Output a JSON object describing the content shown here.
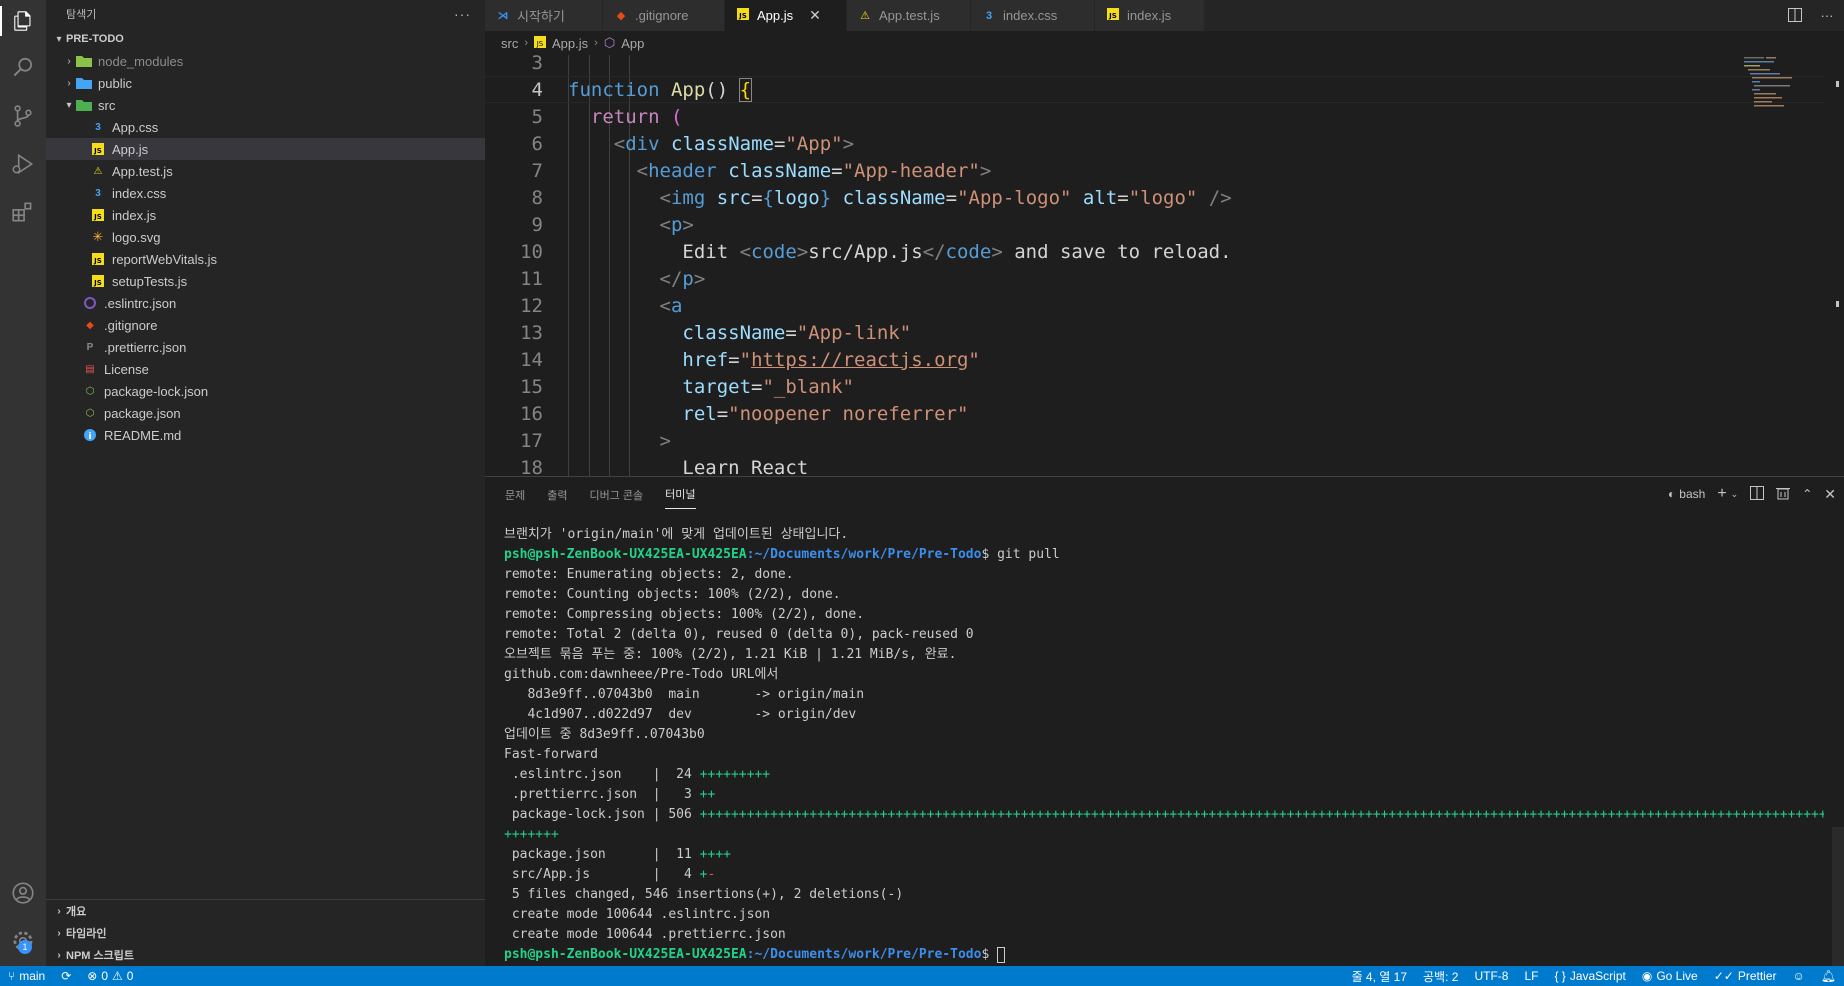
{
  "sidebar": {
    "title": "탐색기",
    "root": "PRE-TODO",
    "items": [
      {
        "label": "node_modules",
        "kind": "folder"
      },
      {
        "label": "public",
        "kind": "folder"
      },
      {
        "label": "src",
        "kind": "folder-open"
      },
      {
        "label": "App.css",
        "kind": "css"
      },
      {
        "label": "App.js",
        "kind": "js"
      },
      {
        "label": "App.test.js",
        "kind": "test"
      },
      {
        "label": "index.css",
        "kind": "css"
      },
      {
        "label": "index.js",
        "kind": "js"
      },
      {
        "label": "logo.svg",
        "kind": "svg"
      },
      {
        "label": "reportWebVitals.js",
        "kind": "js"
      },
      {
        "label": "setupTests.js",
        "kind": "js"
      },
      {
        "label": ".eslintrc.json",
        "kind": "eslint"
      },
      {
        "label": ".gitignore",
        "kind": "git"
      },
      {
        "label": ".prettierrc.json",
        "kind": "prettier"
      },
      {
        "label": "License",
        "kind": "license"
      },
      {
        "label": "package-lock.json",
        "kind": "npm"
      },
      {
        "label": "package.json",
        "kind": "npm"
      },
      {
        "label": "README.md",
        "kind": "info"
      }
    ],
    "bottom_sections": [
      "개요",
      "타임라인",
      "NPM 스크립트"
    ]
  },
  "tabs": [
    {
      "label": "시작하기",
      "icon": "vscode-icon",
      "active": false
    },
    {
      "label": ".gitignore",
      "icon": "git-icon",
      "active": false
    },
    {
      "label": "App.js",
      "icon": "js-icon",
      "active": true
    },
    {
      "label": "App.test.js",
      "icon": "test-icon",
      "active": false
    },
    {
      "label": "index.css",
      "icon": "css-icon",
      "active": false
    },
    {
      "label": "index.js",
      "icon": "js-icon",
      "active": false
    }
  ],
  "breadcrumb": {
    "folder": "src",
    "file": "App.js",
    "symbol": "App"
  },
  "editor": {
    "line_numbers": [
      "3",
      "4",
      "5",
      "6",
      "7",
      "8",
      "9",
      "10",
      "11",
      "12",
      "13",
      "14",
      "15",
      "16",
      "17",
      "18"
    ],
    "current_line": "4",
    "code": {
      "l4_kw": "function",
      "l4_fn": "App",
      "l4_paren": "() ",
      "l4_brace": "{",
      "l5_kw": "return",
      "l5_paren": " (",
      "l6_tag": "div",
      "l6_attr": "className",
      "l6_str": "\"App\"",
      "l7_tag": "header",
      "l7_attr": "className",
      "l7_str": "\"App-header\"",
      "l8_tag": "img",
      "l8_attr1": "src",
      "l8_expr": "logo",
      "l8_attr2": "className",
      "l8_str2": "\"App-logo\"",
      "l8_attr3": "alt",
      "l8_str3": "\"logo\"",
      "l9_tag": "p",
      "l10_text1": "Edit ",
      "l10_tag": "code",
      "l10_text2": "src/App.js",
      "l10_text3": " and save to reload.",
      "l11_tag": "p",
      "l12_tag": "a",
      "l13_attr": "className",
      "l13_str": "\"App-link\"",
      "l14_attr": "href",
      "l14_q1": "\"",
      "l14_url": "https://reactjs.org",
      "l14_q2": "\"",
      "l15_attr": "target",
      "l15_str": "\"_blank\"",
      "l16_attr": "rel",
      "l16_str": "\"noopener noreferrer\"",
      "l17_punct": ">",
      "l18_text": "Learn React"
    }
  },
  "panel": {
    "tabs": [
      "문제",
      "출력",
      "디버그 콘솔",
      "터미널"
    ],
    "active_tab": "터미널",
    "shell": "bash",
    "terminal": {
      "l1": "브랜치가 'origin/main'에 맞게 업데이트된 상태입니다.",
      "prompt_user": "psh@psh-ZenBook-UX425EA-UX425EA",
      "prompt_path": ":~/Documents/work/Pre/Pre-Todo",
      "prompt_cmd": "$ git pull",
      "prompt_end": "$ ",
      "l3": "remote: Enumerating objects: 2, done.",
      "l4": "remote: Counting objects: 100% (2/2), done.",
      "l5": "remote: Compressing objects: 100% (2/2), done.",
      "l6": "remote: Total 2 (delta 0), reused 0 (delta 0), pack-reused 0",
      "l7": "오브젝트 묶음 푸는 중: 100% (2/2), 1.21 KiB | 1.21 MiB/s, 완료.",
      "l8": "github.com:dawnheee/Pre-Todo URL에서",
      "l9": "   8d3e9ff..07043b0  main       -> origin/main",
      "l10": "   4c1d907..d022d97  dev        -> origin/dev",
      "l11": "업데이트 중 8d3e9ff..07043b0",
      "l12": "Fast-forward",
      "f1_name": " .eslintrc.json    |  24 ",
      "f1_plus": "+++++++++",
      "f2_name": " .prettierrc.json  |   3 ",
      "f2_plus": "++",
      "f3_name": " package-lock.json | 506 ",
      "f3_plus": "++++++++++++++++++++++++++++++++++++++++++++++++++++++++++++++++++++++++++++++++++++++++++++++++++++++++++++++++++++++++++++++++++++++++++++++++++",
      "f3_wrap": "+++++++",
      "f4_name": " package.json      |  11 ",
      "f4_plus": "++++",
      "f5_name": " src/App.js        |   4 ",
      "f5_plus": "+",
      "f5_minus": "-",
      "summary": " 5 files changed, 546 insertions(+), 2 deletions(-)",
      "c1": " create mode 100644 .eslintrc.json",
      "c2": " create mode 100644 .prettierrc.json"
    }
  },
  "status_bar": {
    "branch": "main",
    "errors": "0",
    "warnings": "0",
    "position": "줄 4, 열 17",
    "spaces": "공백: 2",
    "encoding": "UTF-8",
    "eol": "LF",
    "language": "JavaScript",
    "golive": "Go Live",
    "prettier": "Prettier"
  },
  "colors": {
    "accent": "#007acc",
    "activity_bar": "#333333",
    "sidebar": "#252526",
    "editor": "#1e1e1e"
  },
  "accounts_badge": "1"
}
